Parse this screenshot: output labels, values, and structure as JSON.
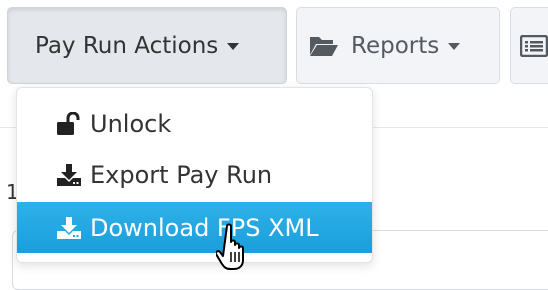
{
  "toolbar": {
    "pay_run_actions_label": "Pay Run Actions",
    "reports_label": "Reports",
    "reports_icon": "folder-open-icon",
    "more_icon": "list-icon"
  },
  "background": {
    "left_digit": "1"
  },
  "menu": {
    "items": [
      {
        "label": "Unlock",
        "icon": "unlock-icon",
        "highlighted": false
      },
      {
        "label": "Export Pay Run",
        "icon": "download-icon",
        "highlighted": false
      },
      {
        "label": "Download FPS XML",
        "icon": "download-icon",
        "highlighted": true
      }
    ]
  },
  "cursor": "hand-pointer",
  "colors": {
    "highlight": "#1fa5e0",
    "button_bg": "#f2f4f7",
    "text": "#333333"
  }
}
